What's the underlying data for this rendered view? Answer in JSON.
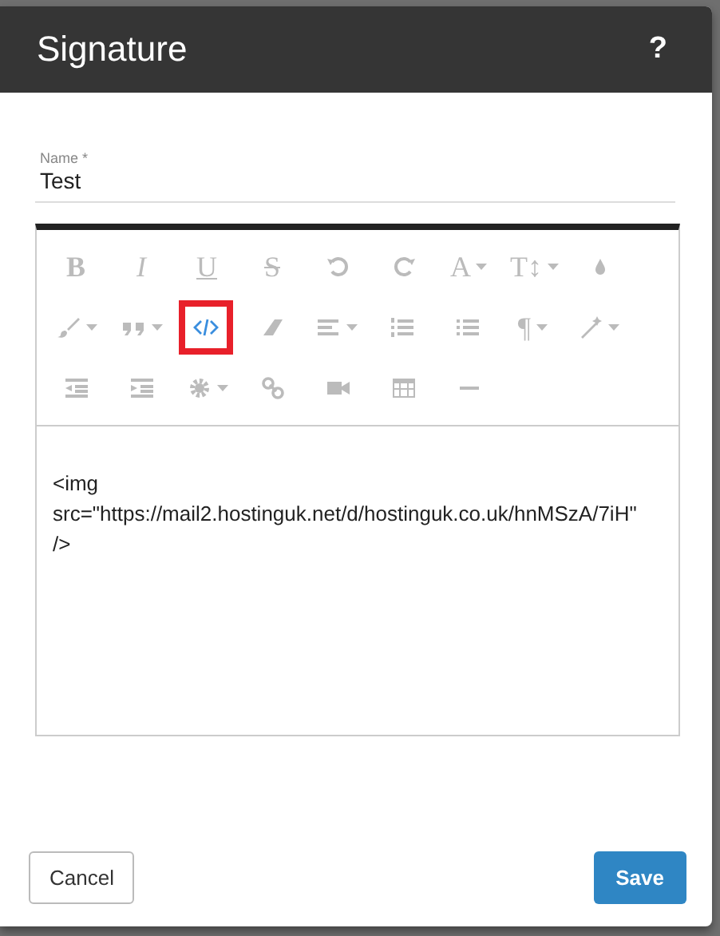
{
  "dialog": {
    "title": "Signature",
    "help": "?"
  },
  "name_field": {
    "label": "Name",
    "required_mark": "*",
    "value": "Test"
  },
  "toolbar": [
    [
      {
        "kind": "bold",
        "label": "B",
        "dropdown": false,
        "selected": false,
        "marked": false
      },
      {
        "kind": "italic",
        "label": "I",
        "dropdown": false,
        "selected": false,
        "marked": false
      },
      {
        "kind": "underline",
        "label": "U",
        "dropdown": false,
        "selected": false,
        "marked": false
      },
      {
        "kind": "strike",
        "label": "S",
        "dropdown": false,
        "selected": false,
        "marked": false
      },
      {
        "kind": "undo",
        "dropdown": false,
        "selected": false,
        "marked": false
      },
      {
        "kind": "redo",
        "dropdown": false,
        "selected": false,
        "marked": false
      },
      {
        "kind": "letter",
        "label": "A",
        "dropdown": true,
        "selected": false,
        "marked": false
      },
      {
        "kind": "letter",
        "label": "T↕",
        "dropdown": true,
        "selected": false,
        "marked": false
      },
      {
        "kind": "drop",
        "dropdown": false,
        "selected": false,
        "marked": false
      }
    ],
    [
      {
        "kind": "brush",
        "dropdown": true,
        "selected": false,
        "marked": false
      },
      {
        "kind": "quote",
        "dropdown": true,
        "selected": false,
        "marked": false
      },
      {
        "kind": "code",
        "dropdown": false,
        "selected": true,
        "marked": true
      },
      {
        "kind": "eraser",
        "dropdown": false,
        "selected": false,
        "marked": false
      },
      {
        "kind": "align",
        "dropdown": true,
        "selected": false,
        "marked": false
      },
      {
        "kind": "ol",
        "dropdown": false,
        "selected": false,
        "marked": false
      },
      {
        "kind": "ul",
        "dropdown": false,
        "selected": false,
        "marked": false
      },
      {
        "kind": "letter",
        "label": "¶",
        "dropdown": true,
        "selected": false,
        "marked": false
      },
      {
        "kind": "wand",
        "dropdown": true,
        "selected": false,
        "marked": false
      }
    ],
    [
      {
        "kind": "outdent",
        "dropdown": false,
        "selected": false,
        "marked": false
      },
      {
        "kind": "indent",
        "dropdown": false,
        "selected": false,
        "marked": false
      },
      {
        "kind": "gear",
        "dropdown": true,
        "selected": false,
        "marked": false
      },
      {
        "kind": "link",
        "dropdown": false,
        "selected": false,
        "marked": false
      },
      {
        "kind": "video",
        "dropdown": false,
        "selected": false,
        "marked": false
      },
      {
        "kind": "table",
        "dropdown": false,
        "selected": false,
        "marked": false
      },
      {
        "kind": "rule",
        "dropdown": false,
        "selected": false,
        "marked": false
      }
    ]
  ],
  "editor_content": "<img src=\"https://mail2.hostinguk.net/d/hostinguk.co.uk/hnMSzA/7iH\" />",
  "buttons": [
    {
      "kind": "secondary",
      "label": "Cancel"
    },
    {
      "kind": "primary",
      "label": "Save"
    }
  ]
}
